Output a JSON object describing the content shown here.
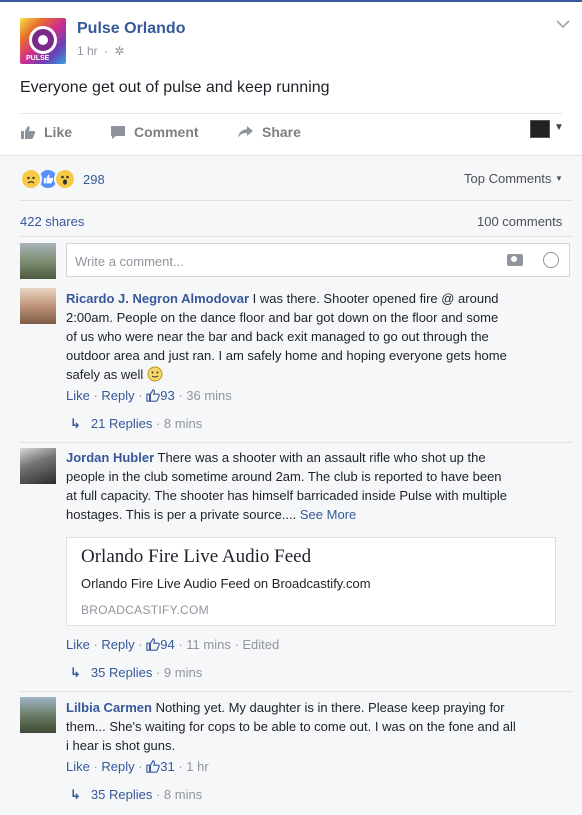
{
  "post": {
    "page_name": "Pulse Orlando",
    "time": "1 hr",
    "text": "Everyone get out of pulse and keep running",
    "logo_text": "PULSE"
  },
  "actions": {
    "like": "Like",
    "comment": "Comment",
    "share": "Share"
  },
  "stats": {
    "reaction_count": "298",
    "sort_label": "Top Comments",
    "shares": "422 shares",
    "comments": "100 comments"
  },
  "composer": {
    "placeholder": "Write a comment..."
  },
  "comments": [
    {
      "author": "Ricardo J. Negron Almodovar",
      "lines": [
        "I was there. Shooter opened fire @ around",
        "2:00am. People on the dance floor and bar got down on the floor and some",
        "of us who were near the bar and back exit managed to go out through the",
        "outdoor area and just ran. I am safely home and hoping everyone gets home",
        "safely as well"
      ],
      "like": "Like",
      "reply": "Reply",
      "likes": "93",
      "time": "36 mins",
      "replies": "21 Replies",
      "replies_time": "8 mins"
    },
    {
      "author": "Jordan Hubler",
      "lines": [
        "There was a shooter with an assault rifle who shot up the",
        "people in the club sometime around 2am. The club is reported to have been",
        "at full capacity. The shooter has himself barricaded inside Pulse with multiple",
        "hostages. This is per a private source...."
      ],
      "see_more": "See More",
      "link_card": {
        "title": "Orlando Fire Live Audio Feed",
        "description": "Orlando Fire Live Audio Feed on Broadcastify.com",
        "domain": "BROADCASTIFY.COM"
      },
      "like": "Like",
      "reply": "Reply",
      "likes": "94",
      "time": "11 mins",
      "edited": "Edited",
      "replies": "35 Replies",
      "replies_time": "9 mins"
    },
    {
      "author": "Lilbia Carmen",
      "lines": [
        "Nothing yet. My daughter is in there. Please keep praying for",
        "them... She's waiting for cops to be able to come out. I was on the fone and all",
        "i hear is shot guns."
      ],
      "like": "Like",
      "reply": "Reply",
      "likes": "31",
      "time": "1 hr",
      "replies": "35 Replies",
      "replies_time": "8 mins"
    }
  ],
  "colors": {
    "link": "#365899",
    "muted": "#90949c",
    "brand": "#3b5998"
  }
}
